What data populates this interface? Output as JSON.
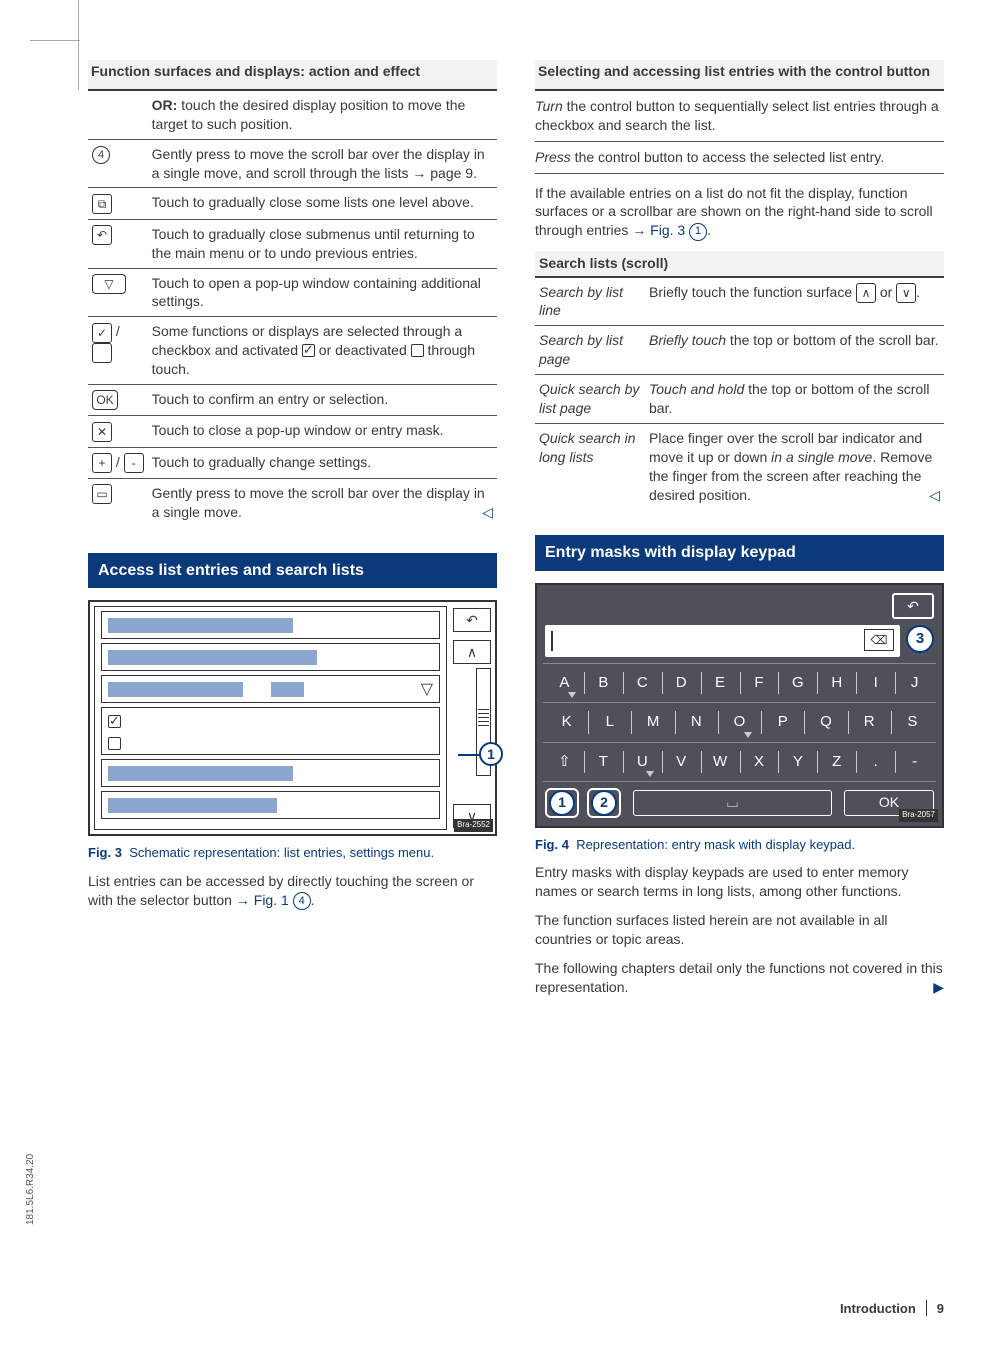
{
  "left": {
    "title": "Function surfaces and displays: action and effect",
    "rows": [
      {
        "text_html": "<b>OR:</b> touch the desired display position to move the target to such position."
      },
      {
        "icon": "④",
        "text": "Gently press to move the scroll bar over the display in a single move, and scroll through the lists → page 9."
      },
      {
        "icon": "close-list",
        "text": "Touch to gradually close some lists one level above."
      },
      {
        "icon": "back",
        "text": "Touch to gradually close submenus until returning to the main menu or to undo previous entries."
      },
      {
        "icon": "popup-open",
        "text": "Touch to open a pop-up window containing additional settings."
      },
      {
        "icon": "check-pair",
        "text": "Some functions or displays are selected through a checkbox and activated ☑ or deactivated ☐ through touch."
      },
      {
        "icon": "OK",
        "text": "Touch to confirm an entry or selection."
      },
      {
        "icon": "x",
        "text": "Touch to close a pop-up window or entry mask."
      },
      {
        "icon": "plus-minus",
        "text": "Touch to gradually change settings."
      },
      {
        "icon": "move",
        "text": "Gently press to move the scroll bar over the display in a single move."
      }
    ],
    "blue_heading": "Access list entries and search lists",
    "fig3": {
      "label": "Fig. 3",
      "caption": "Schematic representation: list entries, settings menu.",
      "bra": "Bra-2552"
    },
    "para1_a": "List entries can be accessed by directly touching the screen or with the selector button ",
    "para1_link": "→ Fig. 1",
    "para1_circ": "④",
    "para1_b": "."
  },
  "right": {
    "title": "Selecting and accessing list entries with the control button",
    "turn_a": "Turn",
    "turn_b": " the control button to sequentially select list entries through a checkbox and search the list.",
    "press_a": "Press",
    "press_b": " the control button to access the selected list entry.",
    "para2_a": "If the available entries on a list do not fit the display, function surfaces or a scrollbar are shown on the right-hand side to scroll through entries ",
    "para2_link": "→ Fig. 3",
    "para2_circ": "①",
    "para2_b": ".",
    "search_head": "Search lists (scroll)",
    "search": [
      {
        "term": "Search by list line",
        "desc_a": "Briefly touch the function surface ",
        "desc_b": "."
      },
      {
        "term": "Search by list page",
        "desc_a": "Briefly touch",
        "desc_b": " the top or bottom of the scroll bar."
      },
      {
        "term": "Quick search by list page",
        "desc_a": "Touch and hold",
        "desc_b": " the top or bottom of the scroll bar."
      },
      {
        "term": "Quick search in long lists",
        "desc": "Place finger over the scroll bar indicator and move it up or down in a single move. Remove the finger from the screen after reaching the desired position."
      }
    ],
    "blue_heading": "Entry masks with display keypad",
    "fig4": {
      "label": "Fig. 4",
      "caption": "Representation: entry mask with display keypad.",
      "row1": [
        "A",
        "B",
        "C",
        "D",
        "E",
        "F",
        "G",
        "H",
        "I",
        "J"
      ],
      "row2": [
        "K",
        "L",
        "M",
        "N",
        "O",
        "P",
        "Q",
        "R",
        "S"
      ],
      "row3": [
        "T",
        "U",
        "V",
        "W",
        "X",
        "Y",
        "Z",
        ".",
        "-"
      ],
      "ok": "OK",
      "bra": "Bra-2057"
    },
    "para3": "Entry masks with display keypads are used to enter memory names or search terms in long lists, among other functions.",
    "para4": "The function surfaces listed herein are not available in all countries or topic areas.",
    "para5": "The following chapters detail only the functions not covered in this representation."
  },
  "footer": {
    "section": "Introduction",
    "page": "9"
  },
  "side": "181.5L6.R34.20"
}
